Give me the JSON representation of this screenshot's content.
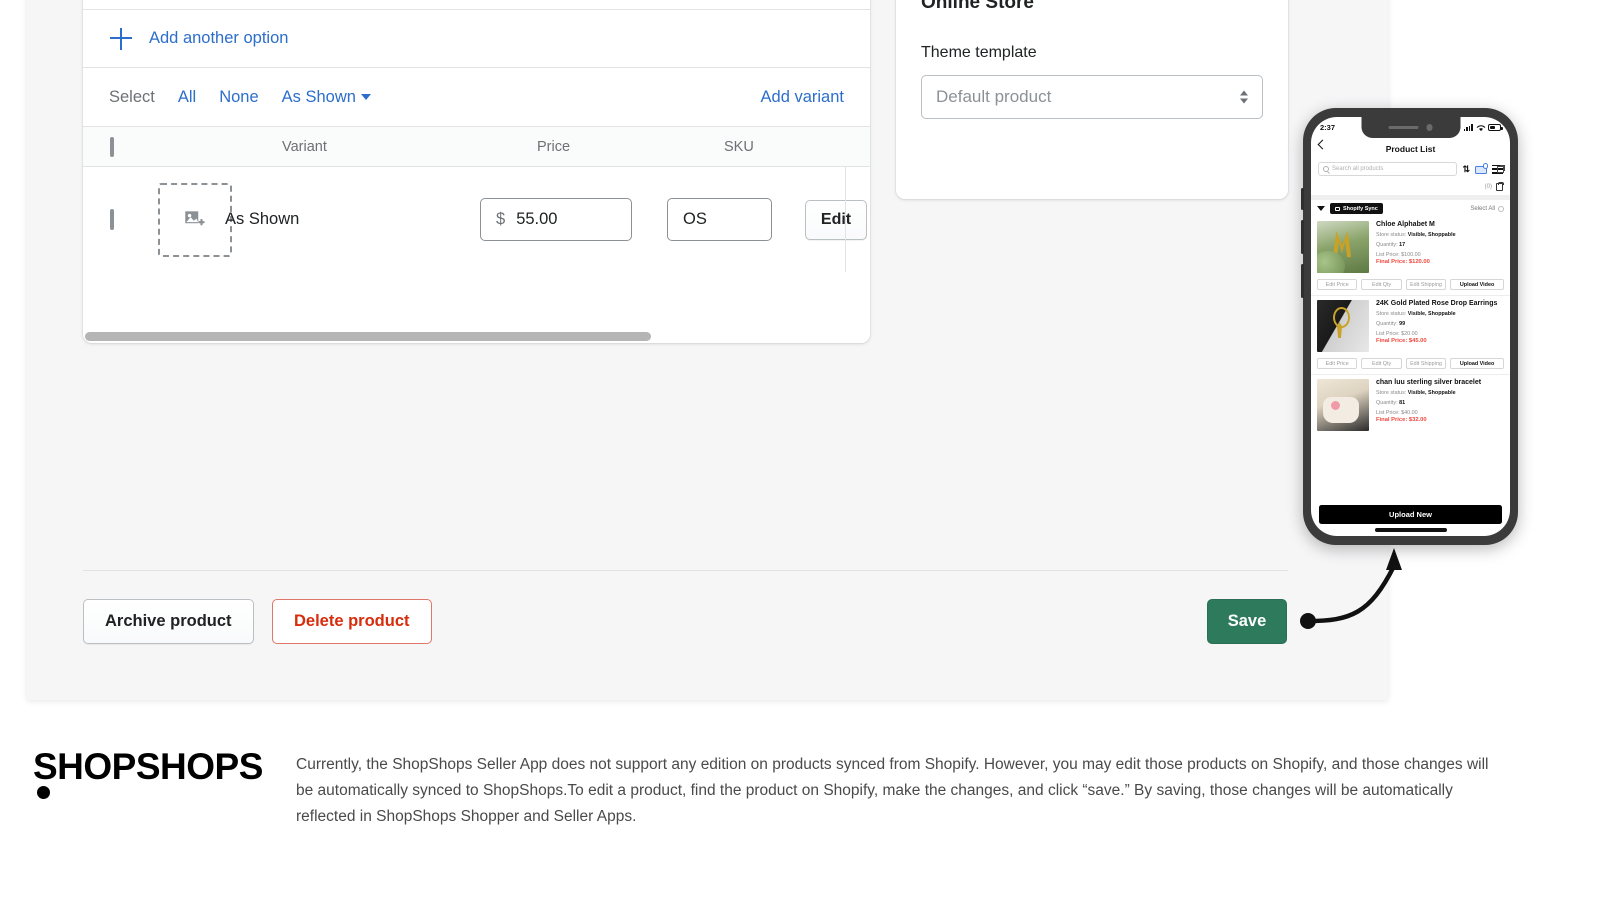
{
  "variants_card": {
    "add_option_label": "Add another option",
    "select_label": "Select",
    "select_links": [
      "All",
      "None"
    ],
    "select_dropdown": "As Shown",
    "add_variant_label": "Add variant",
    "columns": [
      "Variant",
      "Price",
      "SKU"
    ],
    "rows": [
      {
        "variant": "As Shown",
        "currency": "$",
        "price": "55.00",
        "sku": "OS",
        "edit_label": "Edit"
      }
    ]
  },
  "online_store": {
    "title": "Online Store",
    "theme_label": "Theme template",
    "theme_value": "Default product"
  },
  "actions": {
    "archive_label": "Archive product",
    "delete_label": "Delete product",
    "save_label": "Save"
  },
  "phone": {
    "status": {
      "time": "2:37"
    },
    "header_title": "Product List",
    "search_placeholder": "Search all products",
    "cart_count": "(0)",
    "sync_badge": "Shopify Sync",
    "select_all": "Select All",
    "action_labels": [
      "Edit Price",
      "Edit Qty",
      "Edit Shipping",
      "Upload Video"
    ],
    "products": [
      {
        "title": "Chloe Alphabet M",
        "store_status_label": "Store status:",
        "store_status": "Visible, Shoppable",
        "quantity_label": "Quantity:",
        "quantity": "17",
        "list_price_label": "List Price:",
        "list_price": "$100.00",
        "final_price_label": "Final Price:",
        "final_price": "$120.00"
      },
      {
        "title": "24K Gold Plated Rose Drop Earrings",
        "store_status_label": "Store status:",
        "store_status": "Visible, Shoppable",
        "quantity_label": "Quantity:",
        "quantity": "99",
        "list_price_label": "List Price:",
        "list_price": "$20.00",
        "final_price_label": "Final Price:",
        "final_price": "$45.00"
      },
      {
        "title": "chan luu sterling silver bracelet",
        "store_status_label": "Store status:",
        "store_status": "Visible, Shoppable",
        "quantity_label": "Quantity:",
        "quantity": "81",
        "list_price_label": "List Price:",
        "list_price": "$40.00",
        "final_price_label": "Final Price:",
        "final_price": "$32.00"
      }
    ],
    "upload_new_label": "Upload New"
  },
  "footer": {
    "logo_text": "SHOPSHOPS",
    "body": "Currently, the ShopShops Seller App does not support any edition on products synced from Shopify. However, you may edit those products on Shopify, and those changes will be automatically synced to ShopShops.To edit a product, find the product on Shopify, make the changes, and click “save.” By saving, those changes will be automatically reflected in ShopShops Shopper and Seller Apps."
  },
  "colors": {
    "link_blue": "#2c6ecb",
    "save_green": "#2e7a5d",
    "delete_red": "#d72c0d",
    "final_price_red": "#f0463c"
  }
}
